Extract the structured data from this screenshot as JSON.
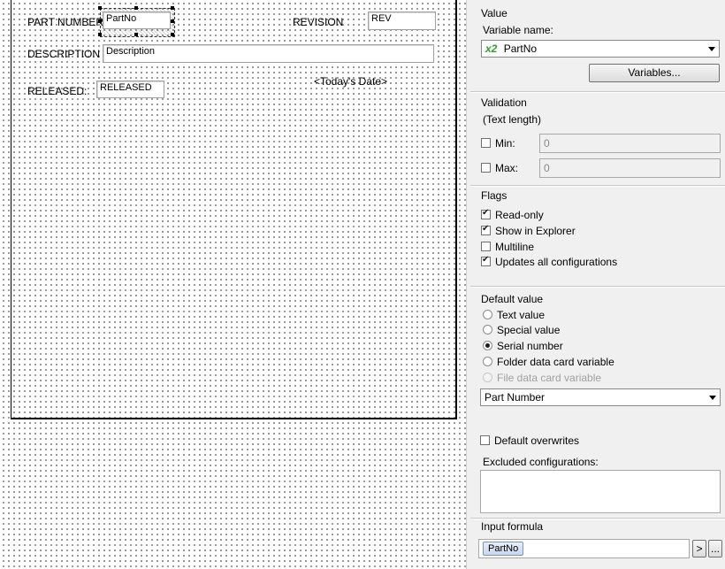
{
  "canvas": {
    "part_number_label": "PART NUMBER",
    "part_number_value": "PartNo",
    "revision_label": "REVISION",
    "revision_value": "REV",
    "description_label": "DESCRIPTION",
    "description_value": "Description",
    "todays_date": "<Today's Date>",
    "released_label": "RELEASED:",
    "released_value": "RELEASED"
  },
  "panel": {
    "value": {
      "section_label": "Value",
      "variable_name_label": "Variable name:",
      "variable_icon_text": "x2",
      "variable_selected": "PartNo",
      "variables_button": "Variables..."
    },
    "validation": {
      "section_label": "Validation",
      "text_length_label": "(Text length)",
      "min_label": "Min:",
      "min_value": "0",
      "min_checked": false,
      "max_label": "Max:",
      "max_value": "0",
      "max_checked": false
    },
    "flags": {
      "section_label": "Flags",
      "items": [
        {
          "label": "Read-only",
          "checked": true
        },
        {
          "label": "Show in Explorer",
          "checked": true
        },
        {
          "label": "Multiline",
          "checked": false
        },
        {
          "label": "Updates all configurations",
          "checked": true
        }
      ]
    },
    "default_value": {
      "section_label": "Default value",
      "options": [
        {
          "label": "Text value",
          "selected": false,
          "enabled": true
        },
        {
          "label": "Special value",
          "selected": false,
          "enabled": true
        },
        {
          "label": "Serial number",
          "selected": true,
          "enabled": true
        },
        {
          "label": "Folder data card variable",
          "selected": false,
          "enabled": true
        },
        {
          "label": "File data card variable",
          "selected": false,
          "enabled": false
        }
      ],
      "serial_selected": "Part Number",
      "default_overwrites_label": "Default overwrites",
      "default_overwrites_checked": false,
      "excluded_configurations_label": "Excluded configurations:"
    },
    "input_formula": {
      "section_label": "Input formula",
      "chip": "PartNo",
      "arrow_button": ">",
      "more_button": "..."
    }
  }
}
